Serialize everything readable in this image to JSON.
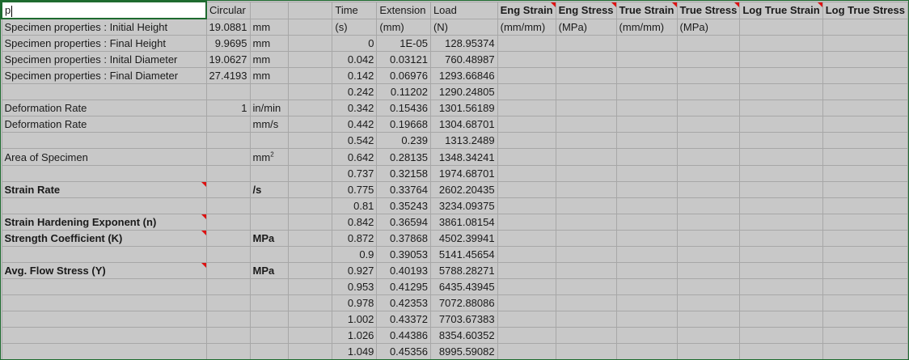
{
  "active_cell_value": "p",
  "header_row": {
    "b": "Circular",
    "f": "Time",
    "g": "Extension",
    "h": "Load",
    "i": "Eng Strain",
    "j": "Eng Stress",
    "k": "True Strain",
    "l": "True Stress",
    "m": "Log True Strain",
    "n": "Log True Stress"
  },
  "units_row": {
    "f": "(s)",
    "g": "(mm)",
    "h": "(N)",
    "i": "(mm/mm)",
    "j": "(MPa)",
    "k": "(mm/mm)",
    "l": "(MPa)"
  },
  "properties": [
    {
      "label": "Specimen properties : Initial Height",
      "value": "19.0881",
      "unit": "mm"
    },
    {
      "label": "Specimen properties : Final Height",
      "value": "9.9695",
      "unit": "mm"
    },
    {
      "label": "Specimen properties : Inital Diameter",
      "value": "19.0627",
      "unit": "mm"
    },
    {
      "label": "Specimen properties : Final Diameter",
      "value": "27.4193",
      "unit": "mm"
    },
    {
      "label": "",
      "value": "",
      "unit": ""
    },
    {
      "label": "Deformation Rate",
      "value": "1",
      "unit": "in/min"
    },
    {
      "label": "Deformation Rate",
      "value": "",
      "unit": "mm/s"
    },
    {
      "label": "",
      "value": "",
      "unit": ""
    },
    {
      "label": "Area of Specimen",
      "value": "",
      "unit": "mm",
      "unit_sup": "2"
    },
    {
      "label": "",
      "value": "",
      "unit": ""
    },
    {
      "label": "Strain Rate",
      "value": "",
      "unit": "/s",
      "bold": true,
      "note": true
    },
    {
      "label": "",
      "value": "",
      "unit": ""
    },
    {
      "label": "Strain Hardening Exponent (n)",
      "value": "",
      "unit": "",
      "bold": true,
      "note": true
    },
    {
      "label": "Strength Coefficient (K)",
      "value": "",
      "unit": "MPa",
      "bold": true,
      "note": true
    },
    {
      "label": "",
      "value": "",
      "unit": ""
    },
    {
      "label": "Avg. Flow Stress (Y)",
      "value": "",
      "unit": "MPa",
      "bold": true,
      "note": true
    },
    {
      "label": "",
      "value": "",
      "unit": ""
    },
    {
      "label": "",
      "value": "",
      "unit": ""
    },
    {
      "label": "",
      "value": "",
      "unit": ""
    },
    {
      "label": "",
      "value": "",
      "unit": ""
    },
    {
      "label": "",
      "value": "",
      "unit": ""
    }
  ],
  "data_rows": [
    {
      "time": "0",
      "extension": "1E-05",
      "load": "128.95374"
    },
    {
      "time": "0.042",
      "extension": "0.03121",
      "load": "760.48987"
    },
    {
      "time": "0.142",
      "extension": "0.06976",
      "load": "1293.66846"
    },
    {
      "time": "0.242",
      "extension": "0.11202",
      "load": "1290.24805"
    },
    {
      "time": "0.342",
      "extension": "0.15436",
      "load": "1301.56189"
    },
    {
      "time": "0.442",
      "extension": "0.19668",
      "load": "1304.68701"
    },
    {
      "time": "0.542",
      "extension": "0.239",
      "load": "1313.2489"
    },
    {
      "time": "0.642",
      "extension": "0.28135",
      "load": "1348.34241"
    },
    {
      "time": "0.737",
      "extension": "0.32158",
      "load": "1974.68701"
    },
    {
      "time": "0.775",
      "extension": "0.33764",
      "load": "2602.20435"
    },
    {
      "time": "0.81",
      "extension": "0.35243",
      "load": "3234.09375"
    },
    {
      "time": "0.842",
      "extension": "0.36594",
      "load": "3861.08154"
    },
    {
      "time": "0.872",
      "extension": "0.37868",
      "load": "4502.39941"
    },
    {
      "time": "0.9",
      "extension": "0.39053",
      "load": "5141.45654"
    },
    {
      "time": "0.927",
      "extension": "0.40193",
      "load": "5788.28271"
    },
    {
      "time": "0.953",
      "extension": "0.41295",
      "load": "6435.43945"
    },
    {
      "time": "0.978",
      "extension": "0.42353",
      "load": "7072.88086"
    },
    {
      "time": "1.002",
      "extension": "0.43372",
      "load": "7703.67383"
    },
    {
      "time": "1.026",
      "extension": "0.44386",
      "load": "8354.60352"
    },
    {
      "time": "1.049",
      "extension": "0.45356",
      "load": "8995.59082"
    }
  ],
  "note_color": "#dd1111",
  "selection_color": "#1e6b2f"
}
